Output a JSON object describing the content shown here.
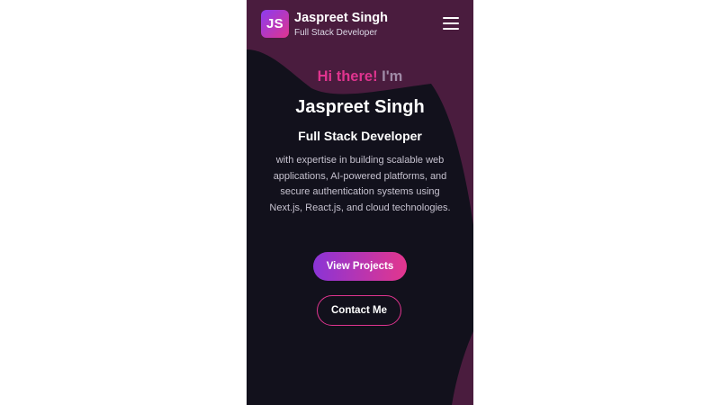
{
  "brand": {
    "initials": "JS",
    "name": "Jaspreet Singh",
    "subtitle": "Full Stack Developer"
  },
  "menu": {
    "icon": "hamburger-menu-icon"
  },
  "hero": {
    "greeting_highlight": "Hi there!",
    "greeting_rest": "I'm",
    "name": "Jaspreet Singh",
    "role": "Full Stack Developer",
    "description": "with expertise in building scalable web applications, AI-powered platforms, and secure authentication systems using Next.js, React.js, and cloud technologies.",
    "primary_button": "View Projects",
    "secondary_button": "Contact Me"
  },
  "colors": {
    "background": "#12111c",
    "accent_pink": "#e0348f",
    "accent_purple": "#8a34d6",
    "decor_shape": "#4a1c3e"
  }
}
